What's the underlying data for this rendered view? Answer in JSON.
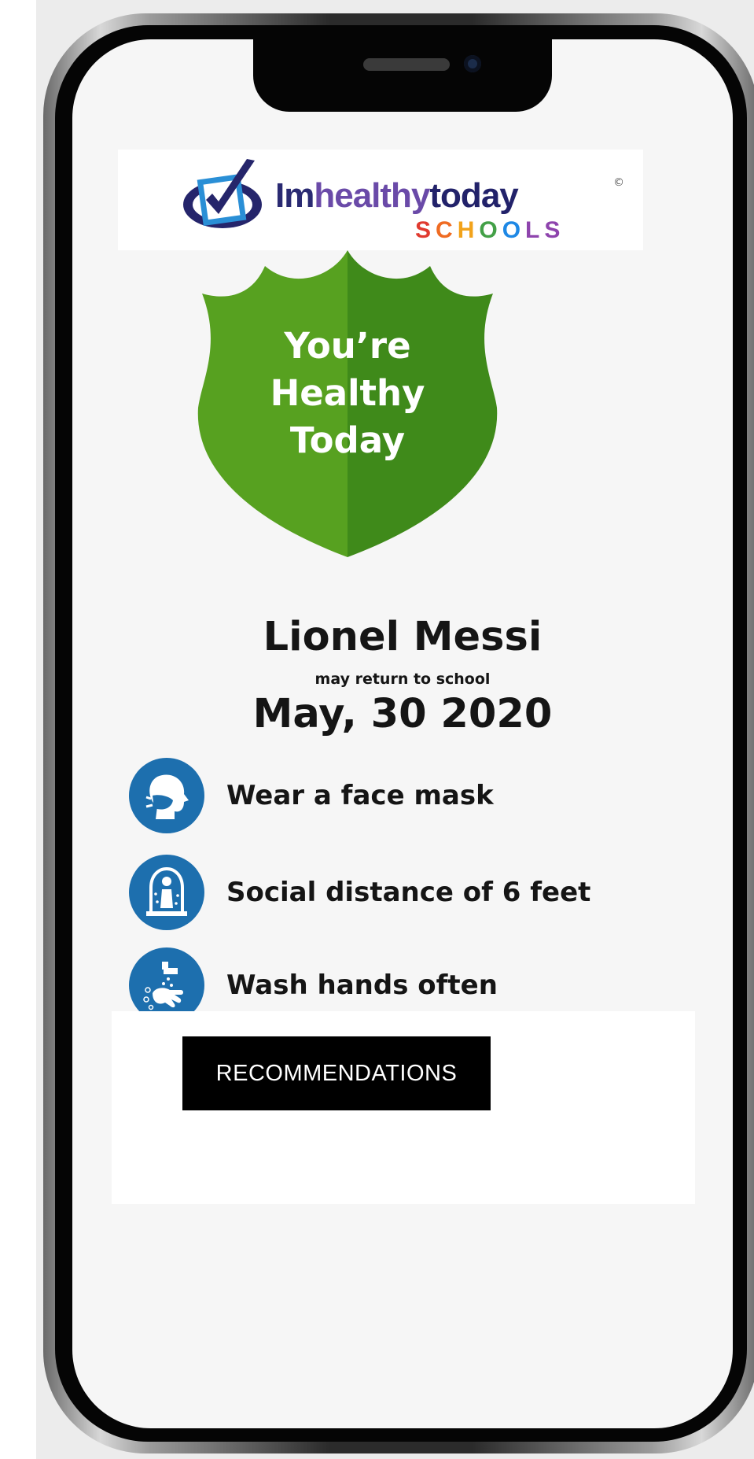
{
  "app": {
    "logo": {
      "brand_im": "Im",
      "brand_healthy": "healthy",
      "brand_today": "today",
      "copyright_mark": "©",
      "schools_letters": [
        "S",
        "C",
        "H",
        "O",
        "O",
        "L",
        "S"
      ],
      "schools_colors": [
        "#e03a2f",
        "#ef6b22",
        "#f2a31b",
        "#43a047",
        "#1e88e5",
        "#8e44ad",
        "#8e44ad"
      ]
    },
    "status_card": {
      "line1": "You’re",
      "line2": "Healthy",
      "line3": "Today",
      "color_light": "#57a120",
      "color_dark": "#3f8a1a"
    },
    "person": {
      "name": "Lionel Messi",
      "note": "may return to school",
      "date": "May, 30 2020"
    },
    "guidelines": [
      {
        "icon": "face-mask-icon",
        "label": "Wear a face mask"
      },
      {
        "icon": "social-distance-icon",
        "label": "Social distance of 6 feet"
      },
      {
        "icon": "hand-wash-icon",
        "label": "Wash hands often"
      }
    ],
    "guideline_icon_color": "#1d6fae",
    "cta": {
      "label": "RECOMMENDATIONS"
    }
  }
}
